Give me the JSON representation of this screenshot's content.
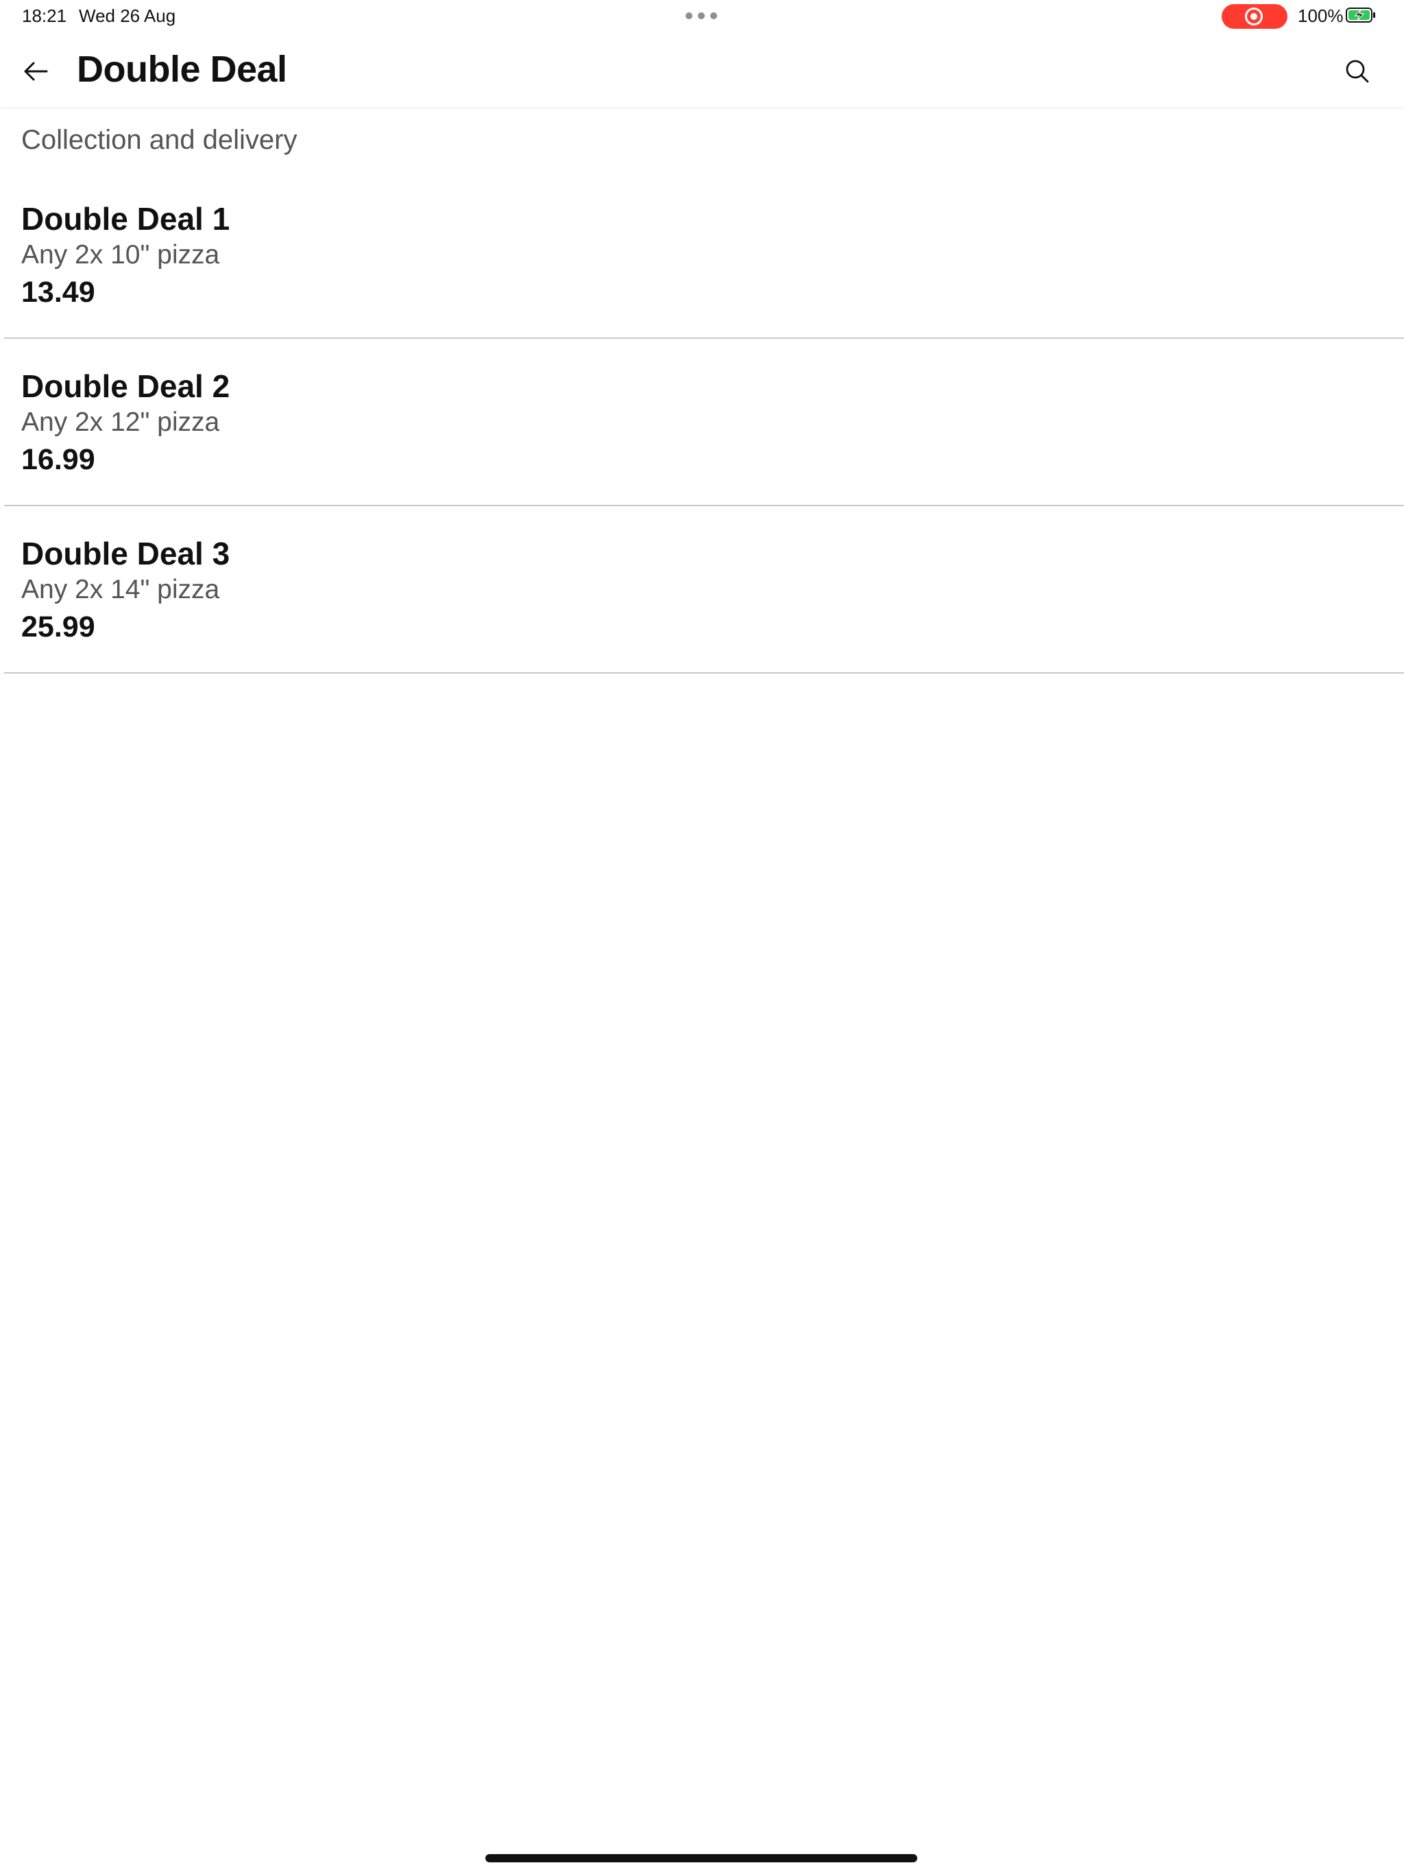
{
  "status_bar": {
    "time": "18:21",
    "date": "Wed 26 Aug",
    "battery_percent": "100%",
    "recording_color": "#ff3b30",
    "battery_charging_color": "#34c759"
  },
  "header": {
    "title": "Double Deal",
    "back_icon": "arrow-left-icon",
    "search_icon": "search-icon"
  },
  "section": {
    "heading": "Collection and delivery"
  },
  "deals": [
    {
      "name": "Double Deal 1",
      "description": "Any 2x 10\" pizza",
      "price": "13.49"
    },
    {
      "name": "Double Deal 2",
      "description": "Any 2x 12\" pizza",
      "price": "16.99"
    },
    {
      "name": "Double Deal 3",
      "description": "Any 2x 14\" pizza",
      "price": "25.99"
    }
  ]
}
